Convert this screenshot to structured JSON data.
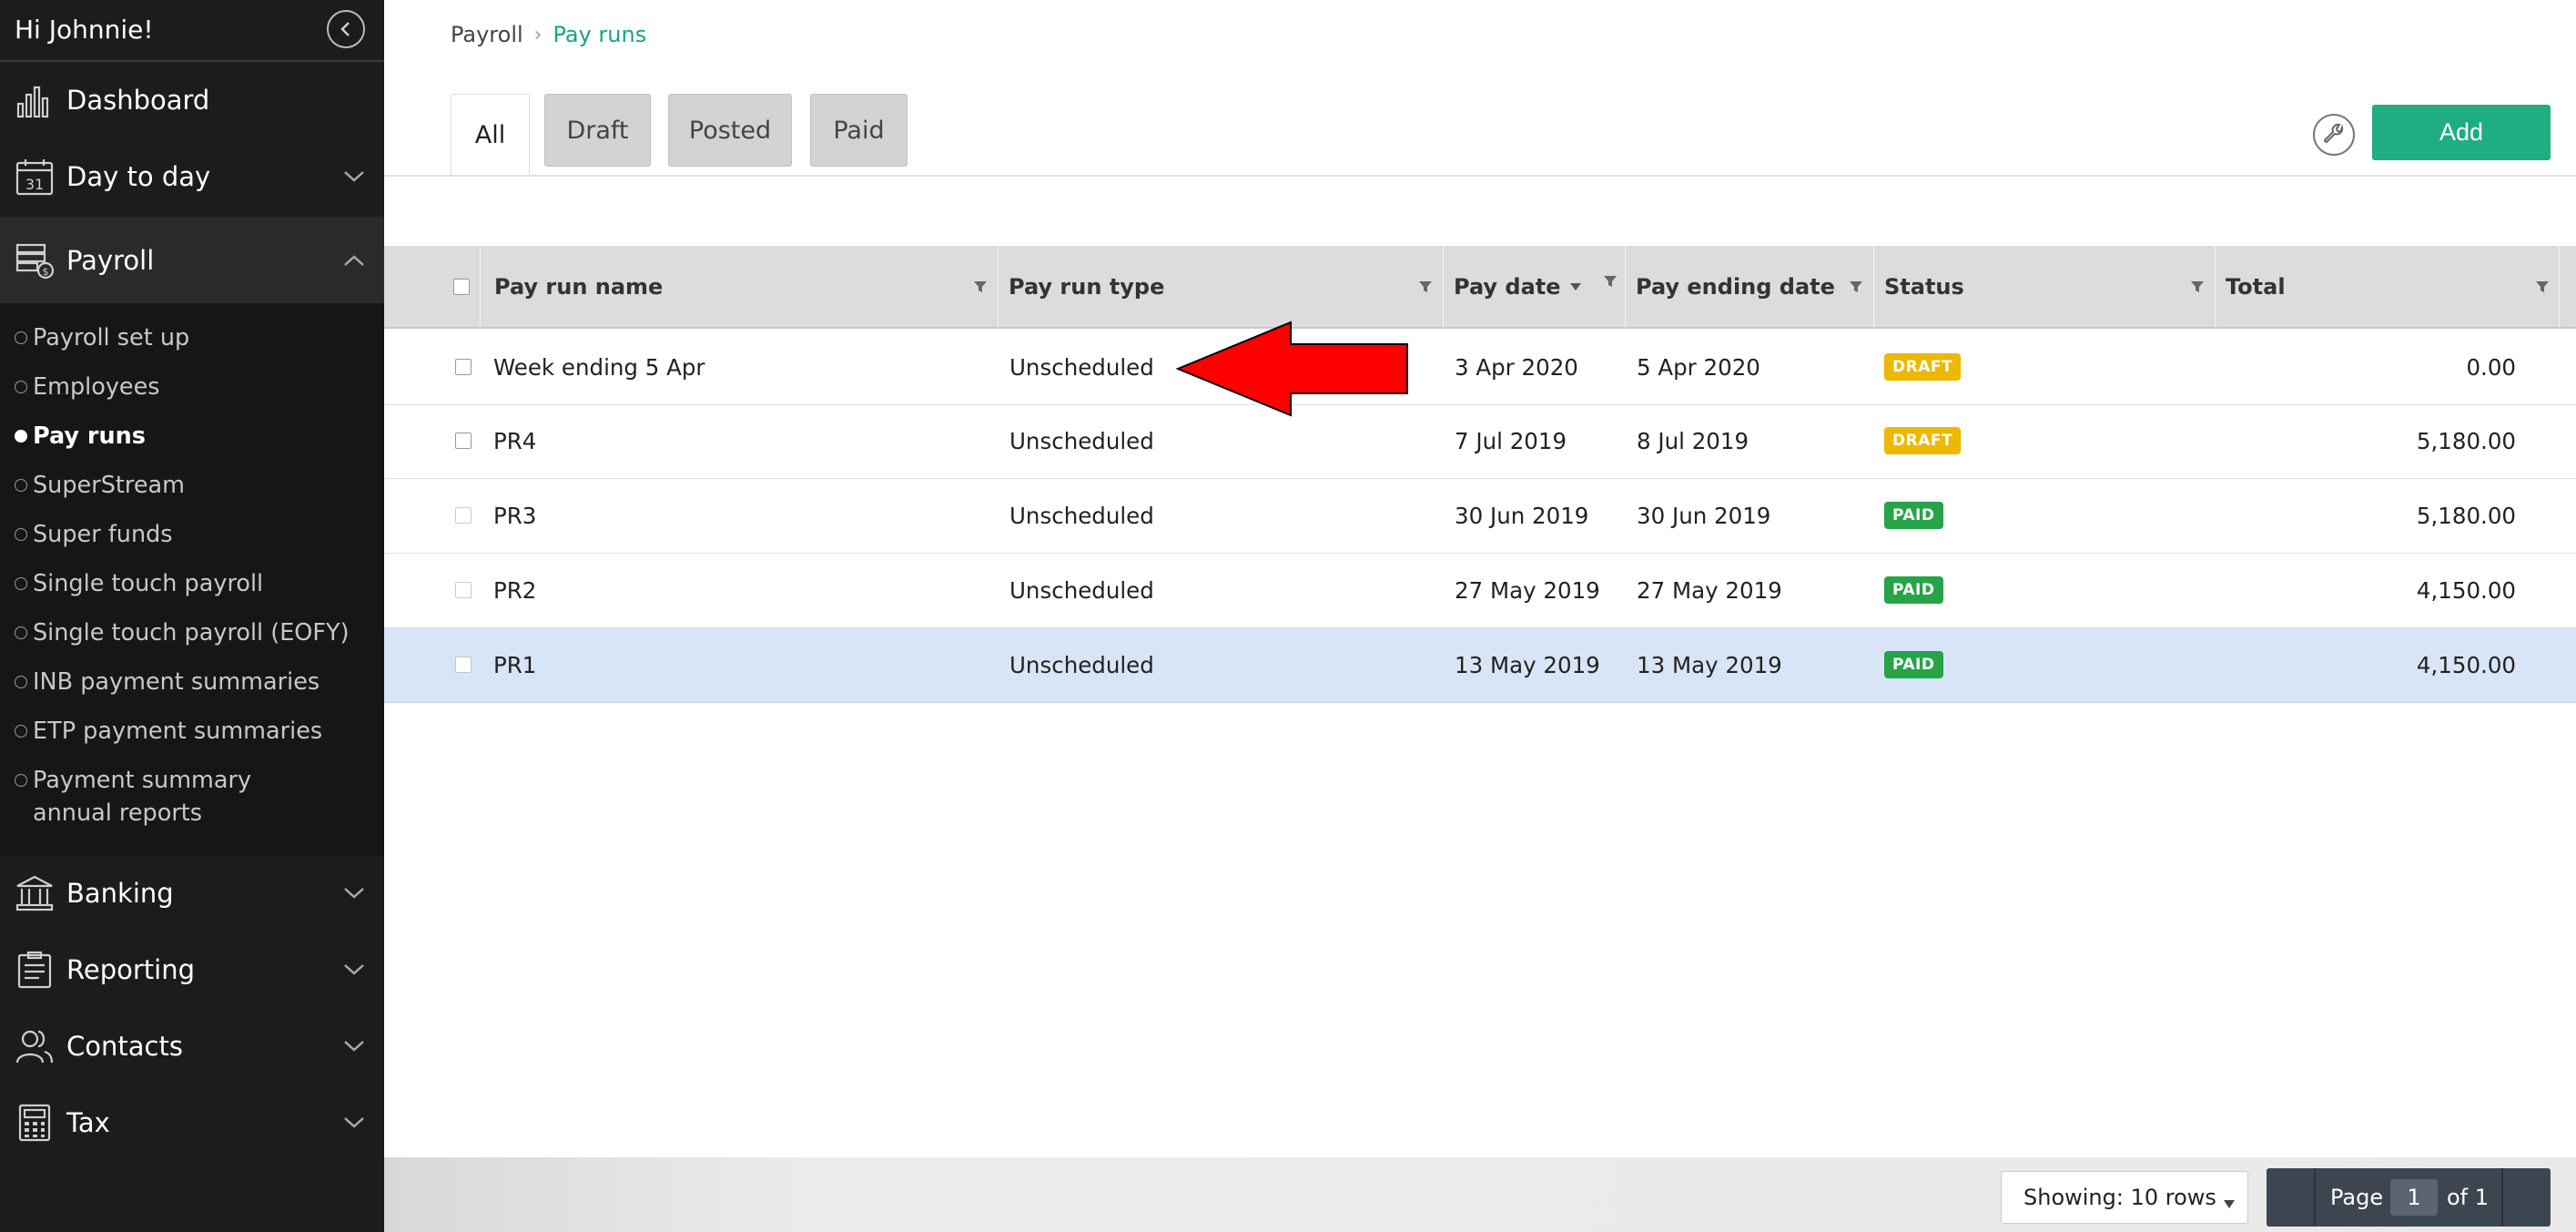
{
  "sidebar": {
    "greeting": "Hi Johnnie!",
    "nav": {
      "dashboard": "Dashboard",
      "day_to_day": "Day to day",
      "payroll": "Payroll",
      "banking": "Banking",
      "reporting": "Reporting",
      "contacts": "Contacts",
      "tax": "Tax"
    },
    "payroll_items": [
      "Payroll set up",
      "Employees",
      "Pay runs",
      "SuperStream",
      "Super funds",
      "Single touch payroll",
      "Single touch payroll (EOFY)",
      "INB payment summaries",
      "ETP payment summaries",
      "Payment summary annual reports"
    ],
    "active_item": "Pay runs"
  },
  "breadcrumb": {
    "parent": "Payroll",
    "current": "Pay runs"
  },
  "tabs": {
    "all": "All",
    "draft": "Draft",
    "posted": "Posted",
    "paid": "Paid",
    "active": "All"
  },
  "toolbar": {
    "add_label": "Add"
  },
  "table": {
    "columns": {
      "name": "Pay run name",
      "type": "Pay run type",
      "pay_date": "Pay date",
      "ending": "Pay ending date",
      "status": "Status",
      "total": "Total"
    },
    "sort_column": "Pay date",
    "rows": [
      {
        "name": "Week ending 5 Apr",
        "type": "Unscheduled",
        "pay_date": "3 Apr 2020",
        "ending": "5 Apr 2020",
        "status": "DRAFT",
        "total": "0.00"
      },
      {
        "name": "PR4",
        "type": "Unscheduled",
        "pay_date": "7 Jul 2019",
        "ending": "8 Jul 2019",
        "status": "DRAFT",
        "total": "5,180.00"
      },
      {
        "name": "PR3",
        "type": "Unscheduled",
        "pay_date": "30 Jun 2019",
        "ending": "30 Jun 2019",
        "status": "PAID",
        "total": "5,180.00"
      },
      {
        "name": "PR2",
        "type": "Unscheduled",
        "pay_date": "27 May 2019",
        "ending": "27 May 2019",
        "status": "PAID",
        "total": "4,150.00"
      },
      {
        "name": "PR1",
        "type": "Unscheduled",
        "pay_date": "13 May 2019",
        "ending": "13 May 2019",
        "status": "PAID",
        "total": "4,150.00",
        "selected": true
      }
    ]
  },
  "footer": {
    "rows_label": "Showing: 10 rows",
    "page_label": "Page",
    "page_number": "1",
    "page_of": "of 1"
  },
  "colors": {
    "accent": "#1fad82",
    "draft": "#ecb800",
    "paid": "#27a348",
    "sidebar": "#1c1c1c",
    "annotation_arrow": "#ff0000"
  }
}
